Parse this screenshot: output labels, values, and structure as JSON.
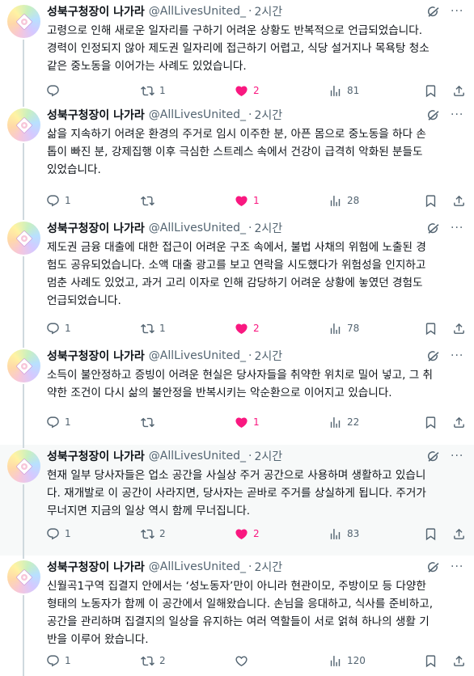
{
  "author": {
    "name": "성북구청장이 나가라",
    "handle": "@AllLivesUnited_",
    "time": "2시간"
  },
  "colors": {
    "like": "#f91880",
    "muted": "#536471",
    "text": "#0f1419"
  },
  "icons": [
    "grok-icon",
    "more-icon",
    "reply-icon",
    "retweet-icon",
    "like-icon",
    "views-icon",
    "bookmark-icon",
    "share-icon"
  ],
  "tweets": [
    {
      "lines": [
        "고령으로 인해 새로운 일자리를 구하기 어려운 상황도 반복적으로 언급되었습니다.",
        "경력이 인정되지 않아 제도권 일자리에 접근하기 어렵고, 식당 설거지나 목욕탕 청소",
        "같은 중노동을 이어가는 사례도 있었습니다."
      ],
      "replies": "",
      "retweets": "1",
      "likes": "2",
      "views": "81",
      "liked": true
    },
    {
      "lines": [
        "삶을 지속하기 어려운 환경의 주거로 임시 이주한 분, 아픈 몸으로 중노동을 하다 손",
        "톱이 빠진 분, 강제집행 이후 극심한 스트레스 속에서 건강이 급격히 악화된 분들도",
        "있었습니다."
      ],
      "replies": "1",
      "retweets": "",
      "likes": "1",
      "views": "28",
      "liked": true
    },
    {
      "lines": [
        "제도권 금융 대출에 대한 접근이 어려운 구조 속에서, 불법 사채의 위험에 노출된 경",
        "험도 공유되었습니다. 소액 대출 광고를 보고 연락을 시도했다가 위험성을 인지하고",
        "멈춘 사례도 있었고, 과거 고리 이자로 인해 감당하기 어려운 상황에 놓였던 경험도",
        "언급되었습니다."
      ],
      "replies": "1",
      "retweets": "1",
      "likes": "2",
      "views": "78",
      "liked": true
    },
    {
      "lines": [
        "소득이 불안정하고 증빙이 어려운 현실은 당사자들을 취약한 위치로 밀어 넣고, 그 취",
        "약한 조건이 다시 삶의 불안정을 반복시키는 악순환으로 이어지고 있습니다."
      ],
      "replies": "1",
      "retweets": "",
      "likes": "1",
      "views": "22",
      "liked": true
    },
    {
      "lines": [
        "현재 일부 당사자들은 업소 공간을 사실상 주거 공간으로 사용하며 생활하고 있습니",
        "다. 재개발로 이 공간이 사라지면, 당사자는 곧바로 주거를 상실하게 됩니다. 주거가",
        "무너지면 지금의 일상 역시 함께 무너집니다."
      ],
      "replies": "1",
      "retweets": "2",
      "likes": "2",
      "views": "83",
      "liked": true
    },
    {
      "lines": [
        "신월곡1구역 집결지 안에서는 ‘성노동자’만이 아니라 현관이모, 주방이모 등 다양한",
        "형태의 노동자가 함께 이 공간에서 일해왔습니다. 손님을 응대하고, 식사를 준비하고,",
        "공간을 관리하며 집결지의 일상을 유지하는 여러 역할들이 서로 얽혀 하나의 생활 기",
        "반을 이루어 왔습니다."
      ],
      "replies": "1",
      "retweets": "2",
      "likes": "",
      "views": "120",
      "liked": false
    }
  ]
}
